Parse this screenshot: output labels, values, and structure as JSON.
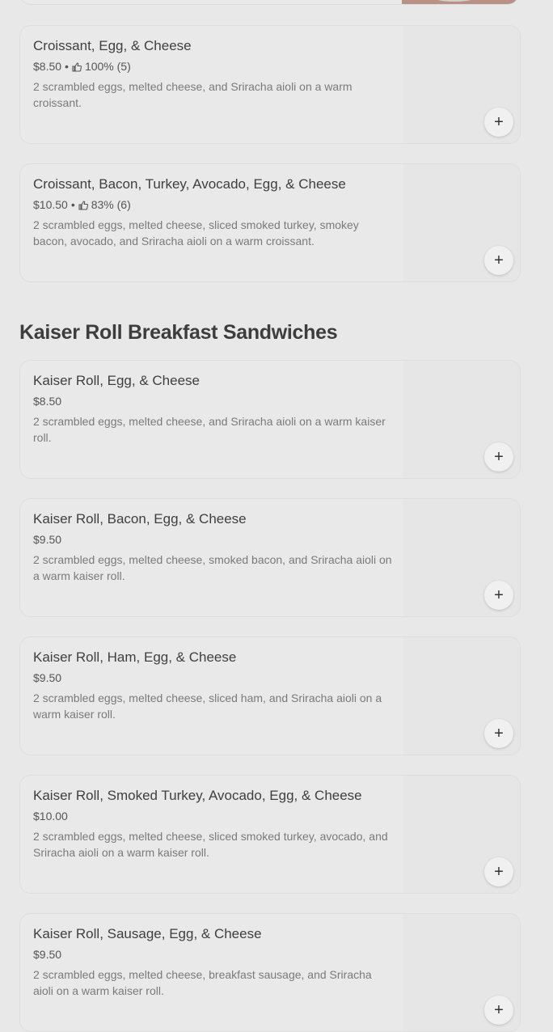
{
  "sections": [
    {
      "title": "",
      "items": [
        {
          "name": "Croissant, Egg, & Cheese",
          "price": "$8.50",
          "rating": "100% (5)",
          "description": "2 scrambled eggs, melted cheese, and Sriracha aioli on a warm croissant."
        },
        {
          "name": "Croissant, Bacon, Turkey, Avocado, Egg, & Cheese",
          "price": "$10.50",
          "rating": "83% (6)",
          "description": "2 scrambled eggs, melted cheese, sliced smoked turkey, smokey bacon, avocado, and Sriracha aioli on a warm croissant."
        }
      ]
    },
    {
      "title": "Kaiser Roll Breakfast Sandwiches",
      "items": [
        {
          "name": "Kaiser Roll, Egg, & Cheese",
          "price": "$8.50",
          "description": "2 scrambled eggs, melted cheese, and Sriracha aioli on a warm kaiser roll."
        },
        {
          "name": "Kaiser Roll, Bacon, Egg, & Cheese",
          "price": "$9.50",
          "description": "2 scrambled eggs, melted cheese, smoked bacon, and Sriracha aioli on a warm kaiser roll."
        },
        {
          "name": "Kaiser Roll, Ham, Egg, & Cheese",
          "price": "$9.50",
          "description": "2 scrambled eggs, melted cheese, sliced ham, and Sriracha aioli on a warm kaiser roll."
        },
        {
          "name": "Kaiser Roll, Smoked Turkey, Avocado, Egg, & Cheese",
          "price": "$10.00",
          "description": "2 scrambled eggs, melted cheese, sliced smoked turkey, avocado, and Sriracha aioli on a warm kaiser roll."
        },
        {
          "name": "Kaiser Roll, Sausage, Egg, & Cheese",
          "price": "$9.50",
          "description": "2 scrambled eggs, melted cheese, breakfast sausage, and Sriracha aioli on a warm kaiser roll."
        }
      ]
    }
  ],
  "icons": {
    "add": "plus-icon",
    "rating": "thumbs-up-icon"
  },
  "add_symbol": "+",
  "separator": "•"
}
